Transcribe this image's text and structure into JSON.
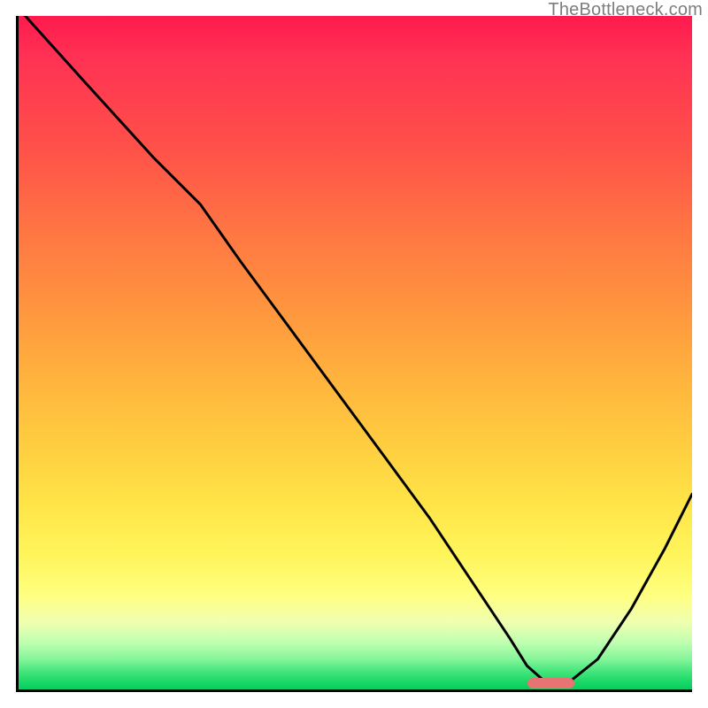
{
  "watermark": "TheBottleneck.com",
  "chart_data": {
    "type": "line",
    "title": "",
    "xlabel": "",
    "ylabel": "",
    "xlim": [
      0,
      100
    ],
    "ylim": [
      0,
      100
    ],
    "x": [
      1,
      10,
      20,
      27,
      33,
      40,
      47,
      54,
      61,
      66,
      70,
      73,
      75.5,
      78,
      82,
      86,
      91,
      96,
      100
    ],
    "values": [
      100,
      90,
      79,
      72,
      63.5,
      54,
      44.5,
      35,
      25.5,
      18,
      12,
      7.5,
      3.5,
      1.3,
      1.3,
      4.5,
      12,
      21,
      29
    ],
    "optimum_marker": {
      "x_start": 75.5,
      "x_end": 82,
      "y": 1.3
    },
    "gradient_stops": [
      {
        "pos": 0,
        "color": "#ff1a4d"
      },
      {
        "pos": 50,
        "color": "#ffb73f"
      },
      {
        "pos": 85,
        "color": "#ffff88"
      },
      {
        "pos": 100,
        "color": "#0acd5e"
      }
    ]
  }
}
